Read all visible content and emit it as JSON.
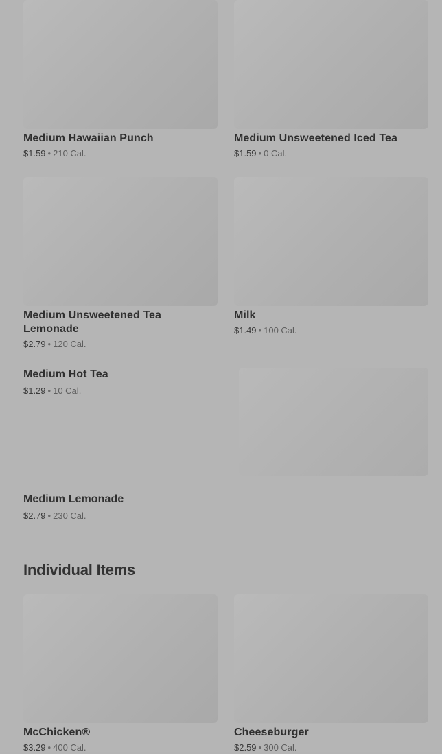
{
  "drinks": [
    {
      "name": "Medium Hawaiian Punch",
      "price": "$1.59",
      "sep": "•",
      "cal": "210 Cal."
    },
    {
      "name": "Medium Unsweetened Iced Tea",
      "price": "$1.59",
      "sep": "•",
      "cal": "0 Cal."
    },
    {
      "name": "Medium Unsweetened Tea Lemonade",
      "price": "$2.79",
      "sep": "•",
      "cal": "120 Cal."
    },
    {
      "name": "Milk",
      "price": "$1.49",
      "sep": "•",
      "cal": "100 Cal."
    },
    {
      "name": "Medium Hot Tea",
      "price": "$1.29",
      "sep": "•",
      "cal": "10 Cal."
    },
    {
      "name": "Medium Lemonade",
      "price": "$2.79",
      "sep": "•",
      "cal": "230 Cal."
    }
  ],
  "section": {
    "title": "Individual Items"
  },
  "individual": [
    {
      "name": "McChicken®",
      "price": "$3.29",
      "sep": "•",
      "cal": "400 Cal."
    },
    {
      "name": "Cheeseburger",
      "price": "$2.59",
      "sep": "•",
      "cal": "300 Cal."
    }
  ]
}
